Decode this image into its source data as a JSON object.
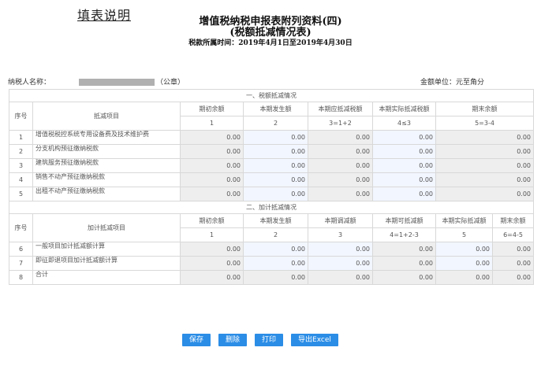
{
  "help_link": "填表说明",
  "title": "增值税纳税申报表附列资料(四)",
  "subtitle": "(税额抵减情况表)",
  "period": "税款所属时间：2019年4月1日至2019年4月30日",
  "taxpayer_label": "纳税人名称：",
  "seal_label": "（公章）",
  "unit_label": "金额单位：元至角分",
  "section1": {
    "title": "一、税额抵减情况",
    "h_seq": "序号",
    "h_item": "抵减项目",
    "cols": [
      "期初余额",
      "本期发生额",
      "本期应抵减税额",
      "本期实际抵减税额",
      "期末余额"
    ],
    "formulas": [
      "1",
      "2",
      "3=1+2",
      "4≤3",
      "5=3-4"
    ],
    "rows": [
      {
        "seq": "1",
        "item": "增值税税控系统专用设备费及技术维护费",
        "v": [
          "0.00",
          "0.00",
          "0.00",
          "0.00",
          "0.00"
        ]
      },
      {
        "seq": "2",
        "item": "分支机构预征缴纳税款",
        "v": [
          "0.00",
          "0.00",
          "0.00",
          "0.00",
          "0.00"
        ]
      },
      {
        "seq": "3",
        "item": "建筑服务预征缴纳税款",
        "v": [
          "0.00",
          "0.00",
          "0.00",
          "0.00",
          "0.00"
        ]
      },
      {
        "seq": "4",
        "item": "销售不动产预征缴纳税款",
        "v": [
          "0.00",
          "0.00",
          "0.00",
          "0.00",
          "0.00"
        ]
      },
      {
        "seq": "5",
        "item": "出租不动产预征缴纳税款",
        "v": [
          "0.00",
          "0.00",
          "0.00",
          "0.00",
          "0.00"
        ]
      }
    ]
  },
  "section2": {
    "title": "二、加计抵减情况",
    "h_seq": "序号",
    "h_item": "加计抵减项目",
    "cols": [
      "期初余额",
      "本期发生额",
      "本期调减额",
      "本期可抵减额",
      "本期实际抵减额",
      "期末余额"
    ],
    "formulas": [
      "1",
      "2",
      "3",
      "4=1+2-3",
      "5",
      "6=4-5"
    ],
    "rows": [
      {
        "seq": "6",
        "item": "一般项目加计抵减额计算",
        "v": [
          "0.00",
          "0.00",
          "0.00",
          "0.00",
          "0.00",
          "0.00"
        ]
      },
      {
        "seq": "7",
        "item": "即征即退项目加计抵减额计算",
        "v": [
          "0.00",
          "0.00",
          "0.00",
          "0.00",
          "0.00",
          "0.00"
        ]
      },
      {
        "seq": "8",
        "item": "合计",
        "v": [
          "0.00",
          "0.00",
          "0.00",
          "0.00",
          "0.00",
          "0.00"
        ]
      }
    ]
  },
  "buttons": {
    "save": "保存",
    "delete": "删除",
    "print": "打印",
    "export": "导出Excel"
  }
}
